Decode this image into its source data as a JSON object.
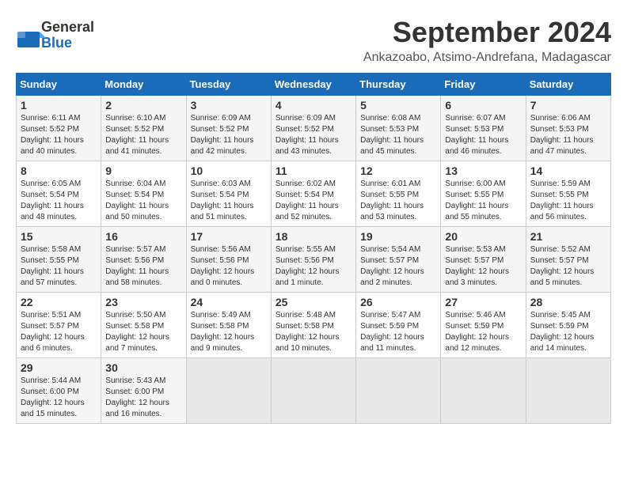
{
  "logo": {
    "text_general": "General",
    "text_blue": "Blue"
  },
  "title": "September 2024",
  "subtitle": "Ankazoabo, Atsimo-Andrefana, Madagascar",
  "days_of_week": [
    "Sunday",
    "Monday",
    "Tuesday",
    "Wednesday",
    "Thursday",
    "Friday",
    "Saturday"
  ],
  "weeks": [
    [
      {
        "day": "1",
        "sunrise": "6:11 AM",
        "sunset": "5:52 PM",
        "daylight": "11 hours and 40 minutes."
      },
      {
        "day": "2",
        "sunrise": "6:10 AM",
        "sunset": "5:52 PM",
        "daylight": "11 hours and 41 minutes."
      },
      {
        "day": "3",
        "sunrise": "6:09 AM",
        "sunset": "5:52 PM",
        "daylight": "11 hours and 42 minutes."
      },
      {
        "day": "4",
        "sunrise": "6:09 AM",
        "sunset": "5:52 PM",
        "daylight": "11 hours and 43 minutes."
      },
      {
        "day": "5",
        "sunrise": "6:08 AM",
        "sunset": "5:53 PM",
        "daylight": "11 hours and 45 minutes."
      },
      {
        "day": "6",
        "sunrise": "6:07 AM",
        "sunset": "5:53 PM",
        "daylight": "11 hours and 46 minutes."
      },
      {
        "day": "7",
        "sunrise": "6:06 AM",
        "sunset": "5:53 PM",
        "daylight": "11 hours and 47 minutes."
      }
    ],
    [
      {
        "day": "8",
        "sunrise": "6:05 AM",
        "sunset": "5:54 PM",
        "daylight": "11 hours and 48 minutes."
      },
      {
        "day": "9",
        "sunrise": "6:04 AM",
        "sunset": "5:54 PM",
        "daylight": "11 hours and 50 minutes."
      },
      {
        "day": "10",
        "sunrise": "6:03 AM",
        "sunset": "5:54 PM",
        "daylight": "11 hours and 51 minutes."
      },
      {
        "day": "11",
        "sunrise": "6:02 AM",
        "sunset": "5:54 PM",
        "daylight": "11 hours and 52 minutes."
      },
      {
        "day": "12",
        "sunrise": "6:01 AM",
        "sunset": "5:55 PM",
        "daylight": "11 hours and 53 minutes."
      },
      {
        "day": "13",
        "sunrise": "6:00 AM",
        "sunset": "5:55 PM",
        "daylight": "11 hours and 55 minutes."
      },
      {
        "day": "14",
        "sunrise": "5:59 AM",
        "sunset": "5:55 PM",
        "daylight": "11 hours and 56 minutes."
      }
    ],
    [
      {
        "day": "15",
        "sunrise": "5:58 AM",
        "sunset": "5:55 PM",
        "daylight": "11 hours and 57 minutes."
      },
      {
        "day": "16",
        "sunrise": "5:57 AM",
        "sunset": "5:56 PM",
        "daylight": "11 hours and 58 minutes."
      },
      {
        "day": "17",
        "sunrise": "5:56 AM",
        "sunset": "5:56 PM",
        "daylight": "12 hours and 0 minutes."
      },
      {
        "day": "18",
        "sunrise": "5:55 AM",
        "sunset": "5:56 PM",
        "daylight": "12 hours and 1 minute."
      },
      {
        "day": "19",
        "sunrise": "5:54 AM",
        "sunset": "5:57 PM",
        "daylight": "12 hours and 2 minutes."
      },
      {
        "day": "20",
        "sunrise": "5:53 AM",
        "sunset": "5:57 PM",
        "daylight": "12 hours and 3 minutes."
      },
      {
        "day": "21",
        "sunrise": "5:52 AM",
        "sunset": "5:57 PM",
        "daylight": "12 hours and 5 minutes."
      }
    ],
    [
      {
        "day": "22",
        "sunrise": "5:51 AM",
        "sunset": "5:57 PM",
        "daylight": "12 hours and 6 minutes."
      },
      {
        "day": "23",
        "sunrise": "5:50 AM",
        "sunset": "5:58 PM",
        "daylight": "12 hours and 7 minutes."
      },
      {
        "day": "24",
        "sunrise": "5:49 AM",
        "sunset": "5:58 PM",
        "daylight": "12 hours and 9 minutes."
      },
      {
        "day": "25",
        "sunrise": "5:48 AM",
        "sunset": "5:58 PM",
        "daylight": "12 hours and 10 minutes."
      },
      {
        "day": "26",
        "sunrise": "5:47 AM",
        "sunset": "5:59 PM",
        "daylight": "12 hours and 11 minutes."
      },
      {
        "day": "27",
        "sunrise": "5:46 AM",
        "sunset": "5:59 PM",
        "daylight": "12 hours and 12 minutes."
      },
      {
        "day": "28",
        "sunrise": "5:45 AM",
        "sunset": "5:59 PM",
        "daylight": "12 hours and 14 minutes."
      }
    ],
    [
      {
        "day": "29",
        "sunrise": "5:44 AM",
        "sunset": "6:00 PM",
        "daylight": "12 hours and 15 minutes."
      },
      {
        "day": "30",
        "sunrise": "5:43 AM",
        "sunset": "6:00 PM",
        "daylight": "12 hours and 16 minutes."
      },
      null,
      null,
      null,
      null,
      null
    ]
  ],
  "labels": {
    "sunrise": "Sunrise:",
    "sunset": "Sunset:",
    "daylight": "Daylight:"
  }
}
